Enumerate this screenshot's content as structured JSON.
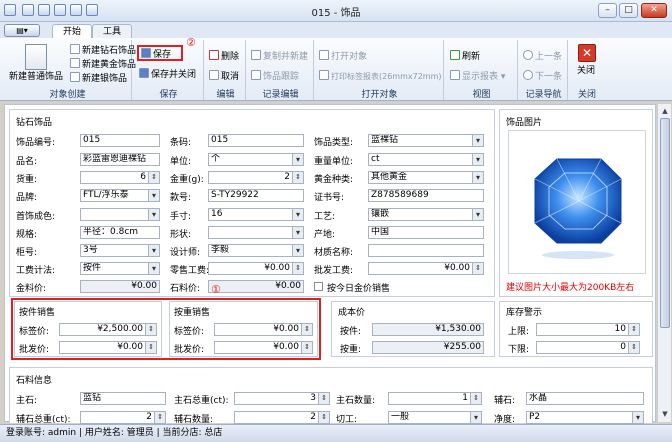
{
  "window": {
    "title": "015 - 饰品"
  },
  "tabs": {
    "app_menu": "▤▾",
    "start": "开始",
    "tools": "工具"
  },
  "ribbon": {
    "create": {
      "label": "对象创建",
      "new_jewelry": "新建普通饰品",
      "new_diamond": "新建钻石饰品",
      "new_gold": "新建黄金饰品",
      "new_silver": "新建银饰品"
    },
    "save": {
      "label": "保存",
      "save": "保存",
      "save_close": "保存并关闭"
    },
    "edit": {
      "label": "编辑",
      "delete": "删除",
      "cancel": "取消"
    },
    "record_edit": {
      "label": "记录编辑",
      "copy_new": "复制并新建",
      "trace": "饰品跟踪"
    },
    "open": {
      "label": "打开对象",
      "open_obj": "打开对象",
      "print_label": "打印标签报表(26mmx72mm)"
    },
    "view": {
      "label": "视图",
      "refresh": "刷新",
      "show_report": "显示报表"
    },
    "nav": {
      "label": "记录导航",
      "prev": "上一条",
      "next": "下一条"
    },
    "close": {
      "label": "关闭",
      "close": "关闭"
    }
  },
  "annotations": {
    "circle1": "①",
    "circle2": "②"
  },
  "diamond": {
    "title": "钻石饰品",
    "labels": {
      "code": "饰品编号:",
      "barcode": "条码:",
      "type": "饰品类型:",
      "name": "品名:",
      "unit": "单位:",
      "weight_unit": "重量单位:",
      "qty": "货重:",
      "gold_weight": "金重(g):",
      "gold_type": "黄金种类:",
      "brand": "品牌:",
      "style": "款号:",
      "cert": "证书号:",
      "color": "首饰成色:",
      "hand": "手寸:",
      "craft": "工艺:",
      "spec": "规格:",
      "shape": "形状:",
      "origin": "产地:",
      "counter": "柜号:",
      "designer": "设计师:",
      "material": "材质名称:",
      "labor_method": "工费计法:",
      "retail_labor": "零售工费:",
      "wholesale_labor": "批发工费:",
      "gold_price": "金料价:",
      "stone_price": "石料价:",
      "daily_gold": "按今日金价销售"
    },
    "values": {
      "code": "015",
      "barcode": "015",
      "type": "蓝裸钻",
      "name": "彩蓝雷恩迪裸钻",
      "unit": "个",
      "weight_unit": "ct",
      "qty": "6",
      "gold_weight": "2",
      "gold_type": "其他黄金",
      "brand": "FTL/浮乐泰",
      "style": "S-TY29922",
      "cert": "Z878589689",
      "color": "",
      "hand": "16",
      "craft": "镶嵌",
      "spec": "半径：0.8cm",
      "shape": "",
      "origin": "中国",
      "counter": "3号",
      "designer": "李毅",
      "material": "",
      "labor_method": "按件",
      "retail_labor": "¥0.00",
      "wholesale_labor": "¥0.00",
      "gold_price": "¥0.00",
      "stone_price": "¥0.00"
    }
  },
  "image_panel": {
    "title": "饰品图片",
    "hint": "建议图片大小最大为200KB左右"
  },
  "sales_piece": {
    "title": "按件销售",
    "label_price_lbl": "标签价:",
    "label_price": "¥2,500.00",
    "wholesale_lbl": "批发价:",
    "wholesale": "¥0.00"
  },
  "sales_weight": {
    "title": "按重销售",
    "label_price_lbl": "标签价:",
    "label_price": "¥0.00",
    "wholesale_lbl": "批发价:",
    "wholesale": "¥0.00"
  },
  "cost": {
    "title": "成本价",
    "by_piece_lbl": "按件:",
    "by_piece": "¥1,530.00",
    "by_weight_lbl": "按重:",
    "by_weight": "¥255.00"
  },
  "stock": {
    "title": "库存警示",
    "upper_lbl": "上限:",
    "upper": "10",
    "lower_lbl": "下限:",
    "lower": "0"
  },
  "stone": {
    "title": "石料信息",
    "main_lbl": "主石:",
    "main": "蓝钻",
    "main_weight_lbl": "主石总重(ct):",
    "main_weight": "3",
    "main_qty_lbl": "主石数量:",
    "main_qty": "1",
    "aux_lbl": "辅石:",
    "aux": "水晶",
    "aux_weight_lbl": "辅石总重(ct):",
    "aux_weight": "2",
    "aux_qty_lbl": "辅石数量:",
    "aux_qty": "2",
    "cut_lbl": "切工:",
    "cut": "一般",
    "clarity_lbl": "净度:",
    "clarity": "P2"
  },
  "status": {
    "text": "登录账号: admin  |  用户姓名: 管理员  |  当前分店: 总店"
  },
  "colors": {
    "accent_red": "#e02020",
    "diamond_blue": "#2f7fe0"
  }
}
